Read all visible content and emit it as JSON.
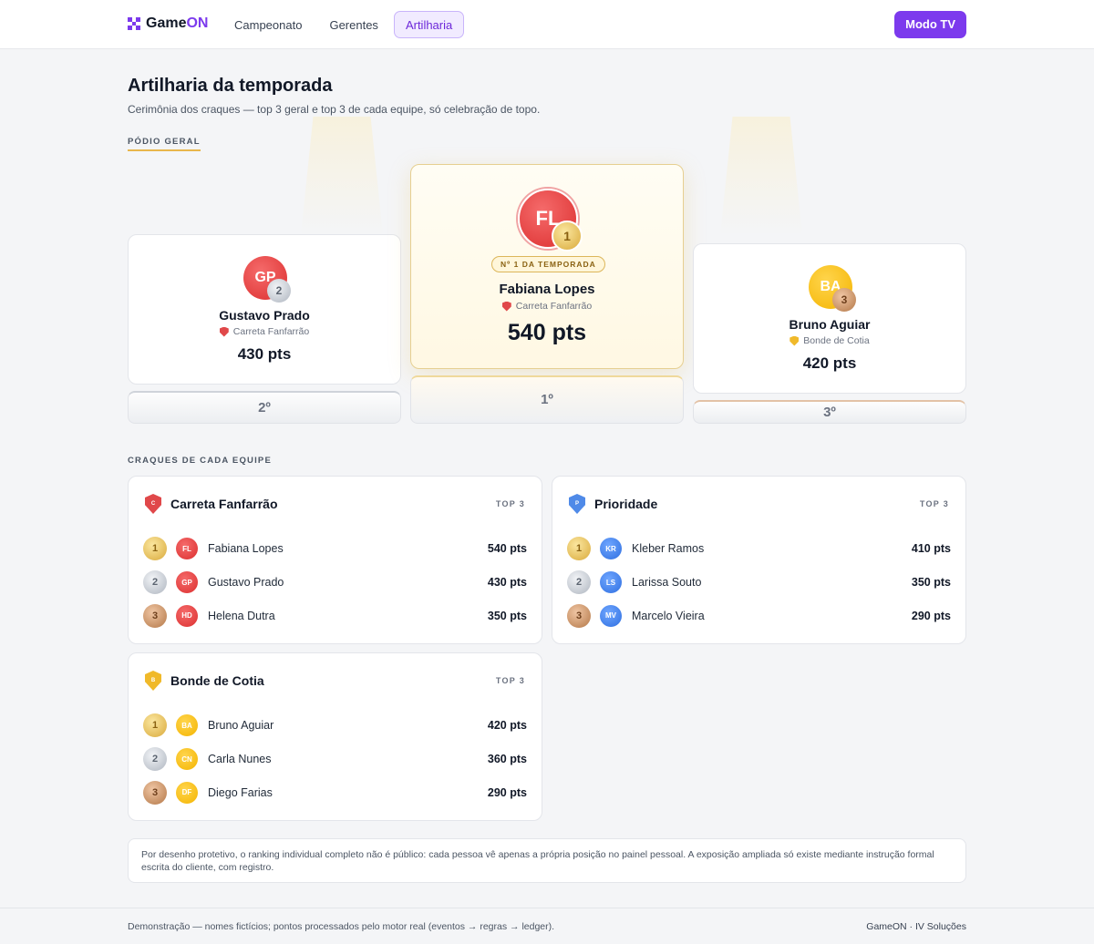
{
  "nav": {
    "brand_game": "Game",
    "brand_on": "ON",
    "items": [
      "Campeonato",
      "Gerentes",
      "Artilharia"
    ],
    "active_index": 2,
    "tv_button": "Modo TV"
  },
  "header": {
    "title": "Artilharia da temporada",
    "subtitle": "Cerimônia dos craques — top 3 geral e top 3 de cada equipe, só celebração de topo."
  },
  "podium": {
    "label": "PÓDIO GERAL",
    "first": {
      "initials": "FL",
      "medal": "1",
      "badge": "Nº 1 DA TEMPORADA",
      "name": "Fabiana Lopes",
      "team": "Carreta Fanfarrão",
      "points": "540 pts",
      "place": "1º"
    },
    "second": {
      "initials": "GP",
      "medal": "2",
      "name": "Gustavo Prado",
      "team": "Carreta Fanfarrão",
      "points": "430 pts",
      "place": "2º"
    },
    "third": {
      "initials": "BA",
      "medal": "3",
      "name": "Bruno Aguiar",
      "team": "Bonde de Cotia",
      "points": "420 pts",
      "place": "3º"
    }
  },
  "teams_label": "CRAQUES DE CADA EQUIPE",
  "teams": [
    {
      "name": "Carreta Fanfarrão",
      "shield_letter": "C",
      "top_label": "TOP 3",
      "players": [
        {
          "rank": "1",
          "initials": "FL",
          "name": "Fabiana Lopes",
          "points": "540 pts"
        },
        {
          "rank": "2",
          "initials": "GP",
          "name": "Gustavo Prado",
          "points": "430 pts"
        },
        {
          "rank": "3",
          "initials": "HD",
          "name": "Helena Dutra",
          "points": "350 pts"
        }
      ]
    },
    {
      "name": "Prioridade",
      "shield_letter": "P",
      "top_label": "TOP 3",
      "players": [
        {
          "rank": "1",
          "initials": "KR",
          "name": "Kleber Ramos",
          "points": "410 pts"
        },
        {
          "rank": "2",
          "initials": "LS",
          "name": "Larissa Souto",
          "points": "350 pts"
        },
        {
          "rank": "3",
          "initials": "MV",
          "name": "Marcelo Vieira",
          "points": "290 pts"
        }
      ]
    },
    {
      "name": "Bonde de Cotia",
      "shield_letter": "B",
      "top_label": "TOP 3",
      "players": [
        {
          "rank": "1",
          "initials": "BA",
          "name": "Bruno Aguiar",
          "points": "420 pts"
        },
        {
          "rank": "2",
          "initials": "CN",
          "name": "Carla Nunes",
          "points": "360 pts"
        },
        {
          "rank": "3",
          "initials": "DF",
          "name": "Diego Farias",
          "points": "290 pts"
        }
      ]
    }
  ],
  "notice": "Por desenho protetivo, o ranking individual completo não é público: cada pessoa vê apenas a própria posição no painel pessoal. A exposição ampliada só existe mediante instrução formal escrita do cliente, com registro.",
  "footer": {
    "left": "Demonstração — nomes fictícios; pontos processados pelo motor real (eventos → regras → ledger).",
    "right": "GameON · IV Soluções"
  },
  "colors": {
    "accent": "#7c3aed",
    "gold": "#d9a93a",
    "team_red": "#e0484a",
    "team_blue": "#4f8ae8",
    "team_gold": "#f0b92a"
  }
}
